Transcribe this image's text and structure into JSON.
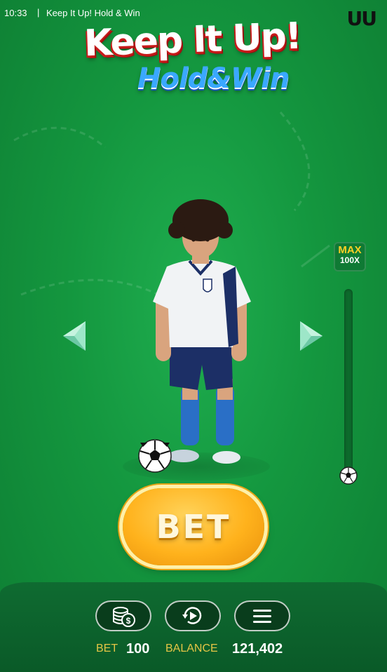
{
  "status_bar": {
    "time": "10:33",
    "separator": "|",
    "title": "Keep It Up! Hold & Win",
    "brand": "UU"
  },
  "logo": {
    "line1": "Keep It Up!",
    "line2": "Hold&Win"
  },
  "multiplier_badge": {
    "label": "MAX",
    "value": "100X"
  },
  "slider": {
    "level": 0
  },
  "navigation": {
    "left_icon": "chevron-left-icon",
    "right_icon": "chevron-right-icon"
  },
  "bet_button": {
    "label": "BET"
  },
  "toolbar": {
    "buttons": [
      {
        "name": "coins",
        "icon": "coins-icon"
      },
      {
        "name": "autoplay",
        "icon": "autoplay-icon"
      },
      {
        "name": "menu",
        "icon": "hamburger-menu-icon"
      }
    ]
  },
  "footer": {
    "bet_label": "BET",
    "bet_value": "100",
    "balance_label": "BALANCE",
    "balance_value": "121,402"
  },
  "colors": {
    "background": "#14973f",
    "bet_button": "#ffb21c",
    "label_gold": "#e4c545",
    "arrow": "#9de6c8",
    "bottom_bar": "#0a5a28"
  }
}
